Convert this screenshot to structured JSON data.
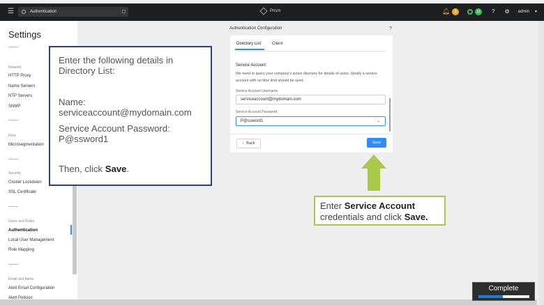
{
  "topbar": {
    "search_text": "Authentication",
    "brand": "Prism",
    "alert_count": "2",
    "task_count": "11",
    "help_glyph": "?",
    "user": "admin",
    "icons": [
      "hamburger-icon",
      "search-icon",
      "bell-icon",
      "settings-icon"
    ]
  },
  "sidebar": {
    "title": "Settings",
    "sections": [
      {
        "label": "Network",
        "items": [
          "HTTP Proxy",
          "Name Servers",
          "NTP Servers",
          "SNMP"
        ]
      },
      {
        "label": "Flow",
        "items": [
          "Microsegmentation"
        ]
      },
      {
        "label": "Security",
        "items": [
          "Cluster Lockdown",
          "SSL Certificate"
        ]
      },
      {
        "label": "Users and Roles",
        "items": [
          "Authentication",
          "Local User Management",
          "Role Mapping"
        ]
      },
      {
        "label": "Email and Alerts",
        "items": [
          "Alert Email Configuration",
          "Alert Policies"
        ]
      }
    ]
  },
  "panel": {
    "title": "Authentication Configuration",
    "help": "?",
    "tabs": [
      "Directory List",
      "Client"
    ],
    "section_title": "Service Account",
    "section_desc": "We need to query your company's active directory for details of users. Ideally a service account with no time limit should be used.",
    "username_label": "Service Account Username",
    "username_value": "serviceaccount@mydomain.com",
    "password_label": "Service Account Password",
    "password_value": "P@ssword1",
    "back_label": "Back",
    "save_label": "Save"
  },
  "callout_main": {
    "intro": "Enter the following details in Directory List:",
    "name_label": "Name:",
    "name_value": "serviceaccount@mydomain.com",
    "password_label": "Service Account Password:",
    "password_value": "P@ssword1",
    "then": "Then, click",
    "save": "Save",
    "period": "."
  },
  "callout_hint": {
    "enter": "Enter",
    "bold": "Service Account",
    "rest": "credentials and click",
    "save": "Save."
  },
  "progress": {
    "label": "Complete",
    "fraction": 0.48
  },
  "colors": {
    "accent": "#2f8df5",
    "callout_blue_border": "#2a3f86",
    "callout_green_border": "#a8c94a",
    "arrow": "#a8c94a"
  }
}
